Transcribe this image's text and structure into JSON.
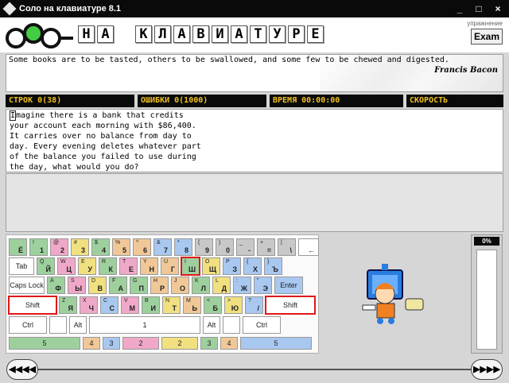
{
  "window": {
    "title": "Соло на клавиатуре 8.1",
    "controls": [
      "_",
      "□",
      "×"
    ]
  },
  "header": {
    "letters": [
      "Н",
      "А",
      "",
      "К",
      "Л",
      "А",
      "В",
      "И",
      "А",
      "Т",
      "У",
      "Р",
      "Е"
    ],
    "mode_label": "упражнение",
    "exam_label": "Exam"
  },
  "quote": {
    "text": "Some books are to be tasted, others to be swallowed, and some few to be chewed and digested.",
    "author": "Francis Bacon"
  },
  "stats": {
    "lines": "СТРОК      0(38)",
    "errors": "ОШИБКИ 0(1000)",
    "time": "ВРЕМЯ 00:00:00",
    "speed": "СКОРОСТЬ"
  },
  "practice": {
    "first_char": "I",
    "first_rest": "magine there is a bank that credits",
    "lines": [
      "your account each morning with $86,400.",
      "It carries over no balance from day to",
      "day. Every evening deletes whatever part",
      "of the balance you failed to use during",
      "the day, what would you do?"
    ]
  },
  "keyboard": {
    "row1": [
      {
        "t": "",
        "m": "Ё",
        "c": "#9ed09e"
      },
      {
        "t": "!",
        "m": "1",
        "c": "#9ed09e"
      },
      {
        "t": "@",
        "m": "2",
        "c": "#f0a8c8"
      },
      {
        "t": "#",
        "m": "3",
        "c": "#f0e080"
      },
      {
        "t": "$",
        "m": "4",
        "c": "#9ed09e"
      },
      {
        "t": "%",
        "m": "5",
        "c": "#f0c898"
      },
      {
        "t": "^",
        "m": "6",
        "c": "#f0c898"
      },
      {
        "t": "&",
        "m": "7",
        "c": "#a8c8f0"
      },
      {
        "t": "*",
        "m": "8",
        "c": "#a8c8f0"
      },
      {
        "t": "(",
        "m": "9",
        "c": "#c8c8c8"
      },
      {
        "t": ")",
        "m": "0",
        "c": "#c8c8c8"
      },
      {
        "t": "_",
        "m": "-",
        "c": "#c8c8c8"
      },
      {
        "t": "+",
        "m": "=",
        "c": "#c8c8c8"
      },
      {
        "t": "|",
        "m": "\\",
        "c": "#c8c8c8"
      },
      {
        "t": "",
        "m": "←",
        "c": "#ffffff"
      }
    ],
    "row2": [
      {
        "label": "Tab",
        "c": "#ffffff"
      },
      {
        "t": "Q",
        "m": "Й",
        "c": "#9ed09e"
      },
      {
        "t": "W",
        "m": "Ц",
        "c": "#f0a8c8"
      },
      {
        "t": "E",
        "m": "У",
        "c": "#f0e080"
      },
      {
        "t": "R",
        "m": "К",
        "c": "#9ed09e"
      },
      {
        "t": "T",
        "m": "Е",
        "c": "#f0a8c8"
      },
      {
        "t": "Y",
        "m": "Н",
        "c": "#f0c898"
      },
      {
        "t": "U",
        "m": "Г",
        "c": "#f0c898"
      },
      {
        "t": "I",
        "m": "Ш",
        "c": "#9ed09e",
        "sel": true
      },
      {
        "t": "O",
        "m": "Щ",
        "c": "#f0e080"
      },
      {
        "t": "P",
        "m": "З",
        "c": "#a8c8f0"
      },
      {
        "t": "{",
        "m": "Х",
        "c": "#a8c8f0"
      },
      {
        "t": "}",
        "m": "Ъ",
        "c": "#a8c8f0"
      }
    ],
    "row3": [
      {
        "label": "Caps Lock",
        "c": "#ffffff"
      },
      {
        "t": "A",
        "m": "Ф",
        "c": "#9ed09e"
      },
      {
        "t": "S",
        "m": "Ы",
        "c": "#f0a8c8"
      },
      {
        "t": "D",
        "m": "В",
        "c": "#f0e080"
      },
      {
        "t": "F",
        "m": "А",
        "c": "#9ed09e"
      },
      {
        "t": "G",
        "m": "П",
        "c": "#9ed09e"
      },
      {
        "t": "H",
        "m": "Р",
        "c": "#f0c898"
      },
      {
        "t": "J",
        "m": "О",
        "c": "#f0c898"
      },
      {
        "t": "K",
        "m": "Л",
        "c": "#9ed09e"
      },
      {
        "t": "L",
        "m": "Д",
        "c": "#f0e080"
      },
      {
        "t": ":",
        "m": "Ж",
        "c": "#a8c8f0"
      },
      {
        "t": "\"",
        "m": "Э",
        "c": "#a8c8f0"
      },
      {
        "label": "Enter",
        "c": "#a8c8f0"
      }
    ],
    "row4": [
      {
        "label": "Shift",
        "c": "#ffffff",
        "sel": true
      },
      {
        "t": "Z",
        "m": "Я",
        "c": "#9ed09e"
      },
      {
        "t": "X",
        "m": "Ч",
        "c": "#f0a8c8"
      },
      {
        "t": "C",
        "m": "С",
        "c": "#a8c8f0"
      },
      {
        "t": "V",
        "m": "М",
        "c": "#f0a8c8"
      },
      {
        "t": "B",
        "m": "И",
        "c": "#9ed09e"
      },
      {
        "t": "N",
        "m": "Т",
        "c": "#f0e080"
      },
      {
        "t": "M",
        "m": "Ь",
        "c": "#f0c898"
      },
      {
        "t": "<",
        "m": "Б",
        "c": "#9ed09e"
      },
      {
        "t": ">",
        "m": "Ю",
        "c": "#f0e080"
      },
      {
        "t": "?",
        "m": "/",
        "c": "#a8c8f0"
      },
      {
        "label": "Shift",
        "c": "#ffffff",
        "sel": true
      }
    ],
    "row5": [
      {
        "label": "Ctrl"
      },
      {
        "label": ""
      },
      {
        "label": "Alt"
      },
      {
        "label": "1"
      },
      {
        "label": "1"
      },
      {
        "label": "Alt"
      },
      {
        "label": ""
      },
      {
        "label": "Ctrl"
      }
    ],
    "fingers": [
      {
        "label": "5",
        "c": "#9ed09e"
      },
      {
        "label": "4",
        "c": "#f0c898"
      },
      {
        "label": "3",
        "c": "#a8c8f0"
      },
      {
        "label": "2",
        "c": "#f0a8c8"
      },
      {
        "label": "2",
        "c": "#f0e080"
      },
      {
        "label": "3",
        "c": "#9ed09e"
      },
      {
        "label": "4",
        "c": "#f0c898"
      },
      {
        "label": "5",
        "c": "#a8c8f0"
      }
    ]
  },
  "gauge": {
    "label": "0%",
    "value": 0
  },
  "nav": {
    "prev": "◀◀◀◀",
    "next": "▶▶▶▶"
  }
}
